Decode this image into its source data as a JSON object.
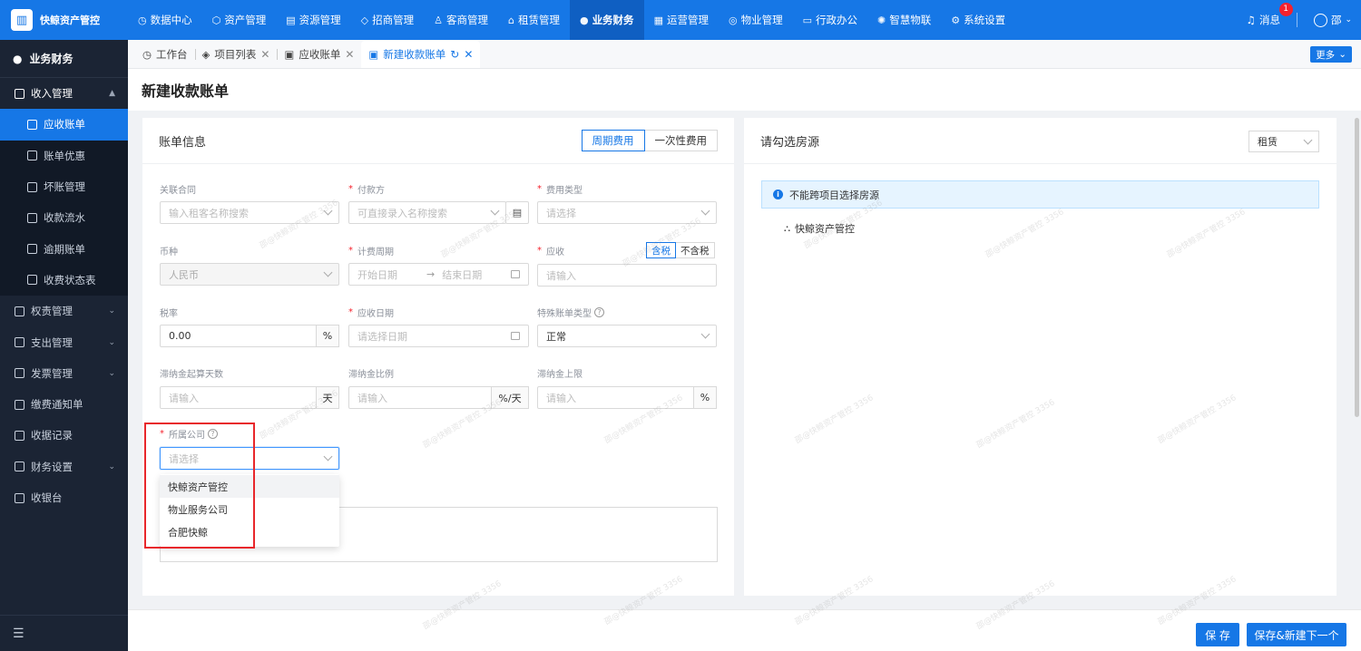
{
  "brand": {
    "name": "快鲸资产管控"
  },
  "topnav": [
    {
      "label": "数据中心",
      "icon": "dashboard-icon"
    },
    {
      "label": "资产管理",
      "icon": "cube-icon"
    },
    {
      "label": "资源管理",
      "icon": "building-icon"
    },
    {
      "label": "招商管理",
      "icon": "tag-icon"
    },
    {
      "label": "客商管理",
      "icon": "users-icon"
    },
    {
      "label": "租赁管理",
      "icon": "home-icon"
    },
    {
      "label": "业务财务",
      "icon": "coin-icon",
      "active": true
    },
    {
      "label": "运营管理",
      "icon": "chart-icon"
    },
    {
      "label": "物业管理",
      "icon": "property-icon"
    },
    {
      "label": "行政办公",
      "icon": "monitor-icon"
    },
    {
      "label": "智慧物联",
      "icon": "iot-icon"
    },
    {
      "label": "系统设置",
      "icon": "gear-icon"
    }
  ],
  "header_right": {
    "messages_label": "消息",
    "message_count": "1",
    "user_name": "邵"
  },
  "sidebar": {
    "title": "业务财务",
    "groups": [
      {
        "label": "收入管理",
        "expanded": true,
        "children": [
          {
            "label": "应收账单",
            "active": true
          },
          {
            "label": "账单优惠"
          },
          {
            "label": "坏账管理"
          },
          {
            "label": "收款流水"
          },
          {
            "label": "逾期账单"
          },
          {
            "label": "收费状态表"
          }
        ]
      },
      {
        "label": "权责管理",
        "has_children": true
      },
      {
        "label": "支出管理",
        "has_children": true
      },
      {
        "label": "发票管理",
        "has_children": true
      },
      {
        "label": "缴费通知单"
      },
      {
        "label": "收据记录"
      },
      {
        "label": "财务设置",
        "has_children": true
      },
      {
        "label": "收银台"
      }
    ]
  },
  "tabs": [
    {
      "label": "工作台"
    },
    {
      "label": "项目列表"
    },
    {
      "label": "应收账单"
    },
    {
      "label": "新建收款账单",
      "active": true
    }
  ],
  "more_label": "更多",
  "page_title": "新建收款账单",
  "bill_form": {
    "title": "账单信息",
    "fee_modes": [
      "周期费用",
      "一次性费用"
    ],
    "related_contract": {
      "label": "关联合同",
      "placeholder": "输入租客名称搜索"
    },
    "payer": {
      "label": "付款方",
      "placeholder": "可直接录入名称搜索"
    },
    "fee_type": {
      "label": "费用类型",
      "placeholder": "请选择"
    },
    "currency": {
      "label": "币种",
      "value": "人民币"
    },
    "billing_period": {
      "label": "计费周期",
      "start_placeholder": "开始日期",
      "end_placeholder": "结束日期",
      "separator": "→"
    },
    "receivable": {
      "label": "应收",
      "tax_options": [
        "含税",
        "不含税"
      ],
      "placeholder": "请输入"
    },
    "tax_rate": {
      "label": "税率",
      "value": "0.00",
      "suffix": "%"
    },
    "due_date": {
      "label": "应收日期",
      "placeholder": "请选择日期"
    },
    "special_type": {
      "label": "特殊账单类型",
      "value": "正常"
    },
    "late_fee_days": {
      "label": "滞纳金起算天数",
      "placeholder": "请输入",
      "suffix": "天"
    },
    "late_fee_ratio": {
      "label": "滞纳金比例",
      "placeholder": "请输入",
      "suffix": "%/天"
    },
    "late_fee_cap": {
      "label": "滞纳金上限",
      "placeholder": "请输入",
      "suffix": "%"
    },
    "company": {
      "label": "所属公司",
      "placeholder": "请选择",
      "options": [
        "快鲸资产管控",
        "物业服务公司",
        "合肥快鲸"
      ]
    }
  },
  "house_panel": {
    "title": "请勾选房源",
    "type_value": "租赁",
    "notice": "不能跨项目选择房源",
    "tree_root": "快鲸资产管控"
  },
  "footer": {
    "save_label": "保 存",
    "save_new_label": "保存&新建下一个"
  },
  "watermark": "邵@快鲸资产管控 3356",
  "colors": {
    "primary": "#1677e6",
    "sidebar_bg": "#1b2434",
    "highlight_border": "#e8272b"
  }
}
